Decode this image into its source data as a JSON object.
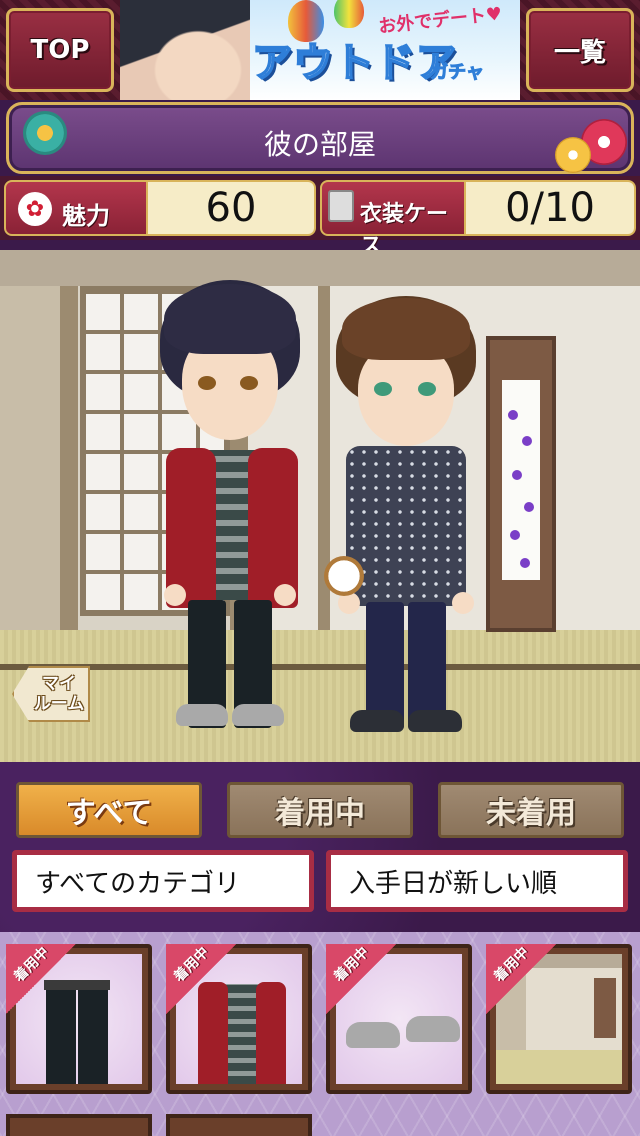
{
  "header": {
    "top_label": "TOP",
    "list_label": "一覧",
    "banner": {
      "sub_text": "お外でデート♥",
      "main_text": "アウトドア",
      "small_text": "ガチャ"
    }
  },
  "room_title": "彼の部屋",
  "stats": {
    "charm_label": "魅力",
    "charm_value": "60",
    "case_label": "衣装ケース",
    "case_value": "0/10"
  },
  "my_room_label": "マイ\nルーム",
  "tabs": [
    {
      "label": "すべて",
      "active": true
    },
    {
      "label": "着用中",
      "active": false
    },
    {
      "label": "未着用",
      "active": false
    }
  ],
  "filters": {
    "category": "すべてのカテゴリ",
    "sort": "入手日が新しい順"
  },
  "items": [
    {
      "name": "black-pants",
      "badge": "着用中"
    },
    {
      "name": "red-cardigan",
      "badge": "着用中"
    },
    {
      "name": "gray-sneakers",
      "badge": "着用中"
    },
    {
      "name": "japanese-room",
      "badge": "着用中"
    }
  ],
  "colors": {
    "accent_gold": "#d9b45a",
    "tab_active": "#e9a040",
    "select_border": "#a82d44"
  }
}
